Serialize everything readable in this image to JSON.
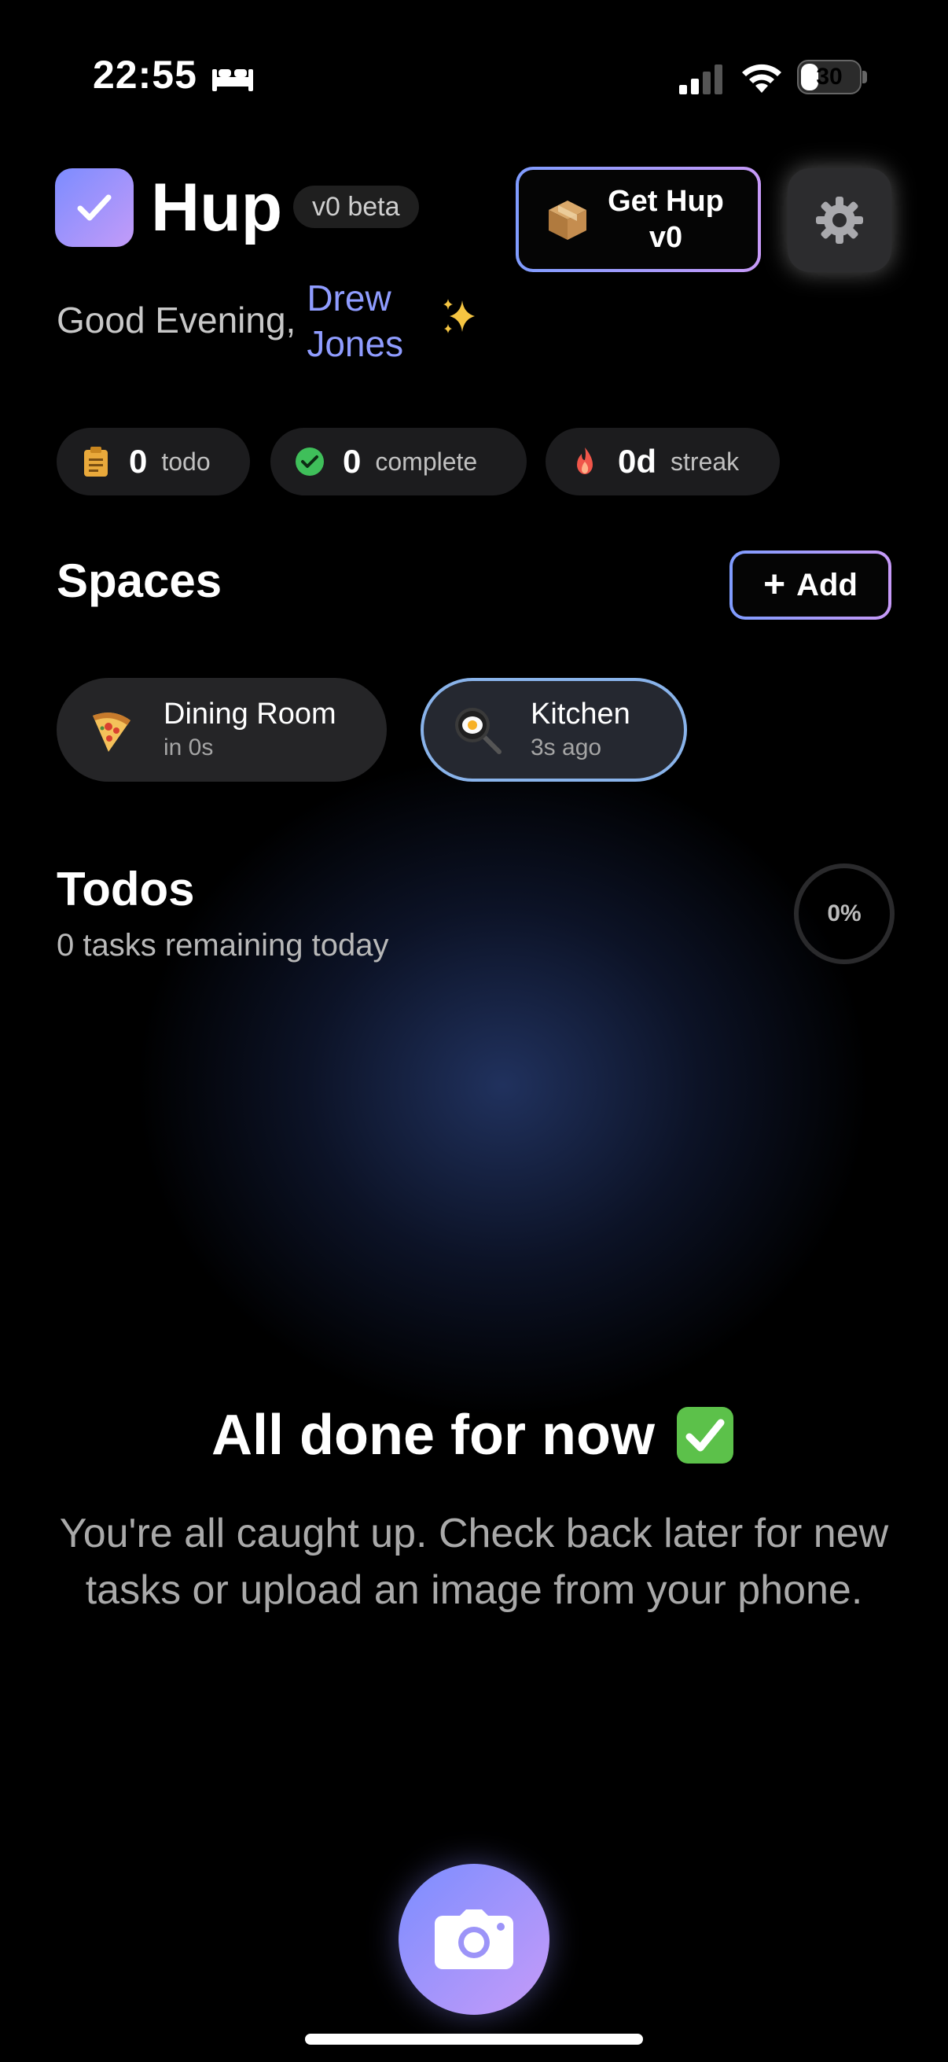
{
  "status_bar": {
    "time": "22:55",
    "battery_level": "30",
    "battery_fraction": 0.3,
    "icons": [
      "bed-icon",
      "cellular-signal-icon",
      "wifi-icon",
      "battery-icon"
    ]
  },
  "header": {
    "app_name": "Hup",
    "version_badge": "v0 beta",
    "get_hup_label_line1": "Get Hup",
    "get_hup_label_line2": "v0",
    "logo_icon": "checkmark-icon",
    "settings_icon": "gear-icon",
    "accent_gradient": [
      "#7f9cff",
      "#c79af8"
    ]
  },
  "greeting": {
    "prefix": "Good Evening,",
    "first_name": "Drew",
    "last_name": "Jones",
    "name_color": "#8f9cff",
    "icon": "sparkles-icon"
  },
  "stats": [
    {
      "icon": "clipboard-icon",
      "value": "0",
      "label": "todo"
    },
    {
      "icon": "check-circle-icon",
      "value": "0",
      "label": "complete"
    },
    {
      "icon": "fire-icon",
      "value": "0d",
      "label": "streak"
    }
  ],
  "spaces": {
    "title": "Spaces",
    "add_label": "Add",
    "items": [
      {
        "name": "Dining Room",
        "time": "in 0s",
        "icon": "pizza-icon",
        "active": false
      },
      {
        "name": "Kitchen",
        "time": "3s ago",
        "icon": "frying-pan-icon",
        "active": true
      }
    ],
    "active_border_color": "#89b3ea"
  },
  "todos": {
    "title": "Todos",
    "subtitle": "0 tasks remaining today",
    "progress_label": "0%",
    "progress_fraction": 0
  },
  "empty_state": {
    "title": "All done for now",
    "icon": "check-mark-button-icon",
    "description": "You're all caught up. Check back later for new tasks or upload an image from your phone."
  },
  "camera_button": {
    "icon": "camera-icon"
  }
}
